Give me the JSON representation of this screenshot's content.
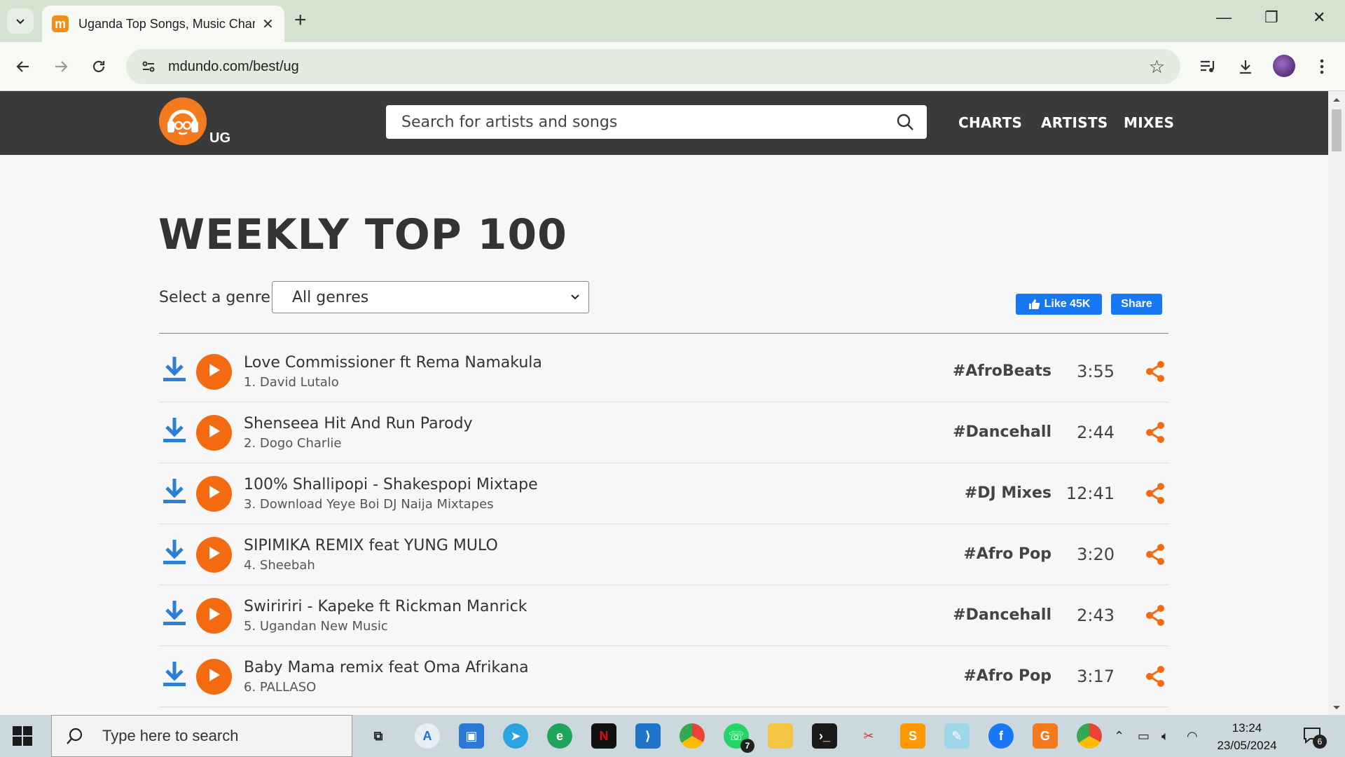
{
  "browser": {
    "tab_title": "Uganda Top Songs, Music Char",
    "favicon_letter": "m",
    "url": "mdundo.com/best/ug"
  },
  "site": {
    "country_code": "UG",
    "search_placeholder": "Search for artists and songs",
    "nav": [
      "CHARTS",
      "ARTISTS",
      "MIXES"
    ],
    "page_title": "WEEKLY TOP 100",
    "genre_label": "Select a genre",
    "genre_selected": "All genres",
    "fb_like": "Like 45K",
    "fb_share": "Share",
    "accent_color": "#f46a10",
    "download_color": "#2b7fd4"
  },
  "songs": [
    {
      "title": "Love Commissioner ft Rema Namakula",
      "artist": "1. David Lutalo",
      "genre": "#AfroBeats",
      "duration": "3:55"
    },
    {
      "title": "Shenseea Hit And Run Parody",
      "artist": "2. Dogo Charlie",
      "genre": "#Dancehall",
      "duration": "2:44"
    },
    {
      "title": "100% Shallipopi - Shakespopi Mixtape",
      "artist": "3. Download Yeye Boi DJ Naija Mixtapes",
      "genre": "#DJ Mixes",
      "duration": "12:41"
    },
    {
      "title": "SIPIMIKA REMIX feat YUNG MULO",
      "artist": "4. Sheebah",
      "genre": "#Afro Pop",
      "duration": "3:20"
    },
    {
      "title": "Swiririri - Kapeke ft Rickman Manrick",
      "artist": "5. Ugandan New Music",
      "genre": "#Dancehall",
      "duration": "2:43"
    },
    {
      "title": "Baby Mama remix feat Oma Afrikana",
      "artist": "6. PALLASO",
      "genre": "#Afro Pop",
      "duration": "3:17"
    }
  ],
  "taskbar": {
    "search_placeholder": "Type here to search",
    "whatsapp_badge": "7",
    "time": "13:24",
    "date": "23/05/2024",
    "notification_count": "6"
  }
}
